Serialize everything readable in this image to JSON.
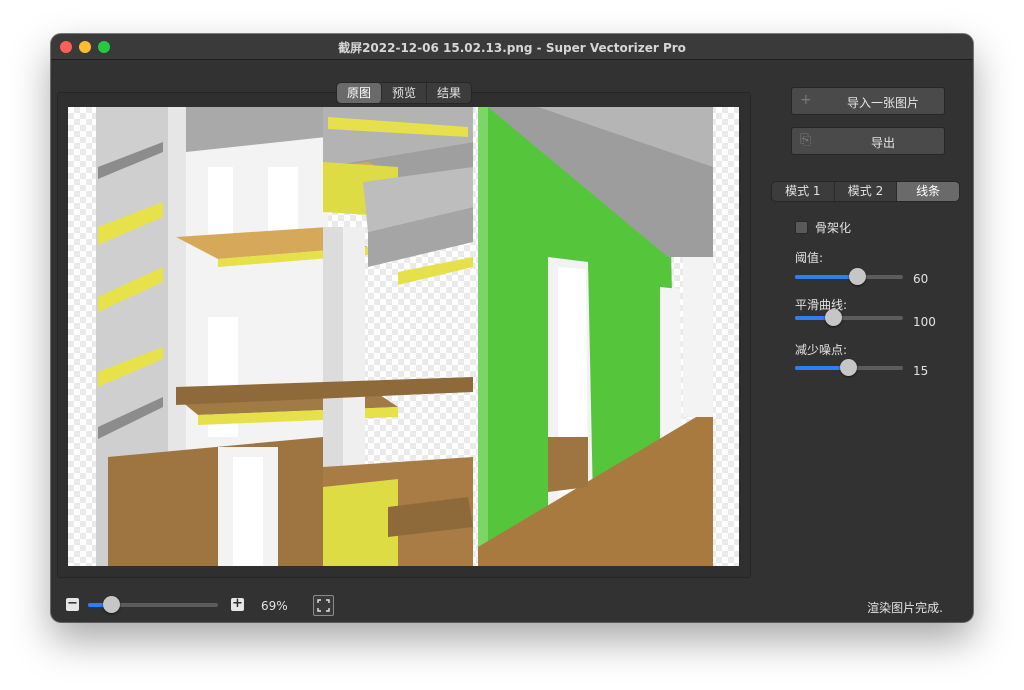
{
  "window": {
    "title": "截屏2022-12-06 15.02.13.png - Super Vectorizer Pro",
    "traffic_colors": [
      "#ff5f57",
      "#febc2e",
      "#28c840"
    ]
  },
  "view_tabs": [
    {
      "label": "原图",
      "active": true
    },
    {
      "label": "预览",
      "active": false
    },
    {
      "label": "结果",
      "active": false
    }
  ],
  "sidebar": {
    "import_label": "导入一张图片",
    "export_label": "导出",
    "modes": [
      {
        "label": "模式 1",
        "active": false
      },
      {
        "label": "模式 2",
        "active": false
      },
      {
        "label": "线条",
        "active": true
      }
    ],
    "skeleton_label": "骨架化",
    "skeleton_checked": false,
    "params": [
      {
        "label": "阈值:",
        "value": "60",
        "fraction": 0.57
      },
      {
        "label": "平滑曲线:",
        "value": "100",
        "fraction": 0.35
      },
      {
        "label": "减少噪点:",
        "value": "15",
        "fraction": 0.49
      }
    ]
  },
  "footer": {
    "zoom_value": "69%",
    "zoom_fraction": 0.18,
    "status": "渲染图片完成."
  },
  "colors": {
    "accent": "#2f7ff0",
    "green_wall": "#55c63c",
    "floor_brown": "#9e7440",
    "yellow": "#e6e04a"
  }
}
